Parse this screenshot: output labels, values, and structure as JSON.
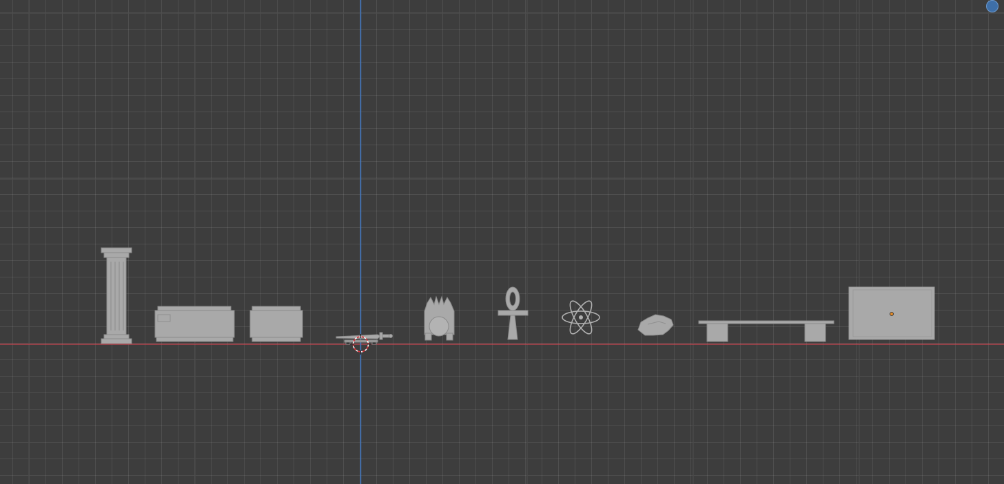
{
  "app": "3D Viewport",
  "view": {
    "mode": "orthographic-front",
    "grid": true
  },
  "axes": {
    "x_axis_color": "#c7444f",
    "z_axis_color": "#3f78c4"
  },
  "colors": {
    "background": "#3d3d3d",
    "mesh": "#a9a9a9",
    "origin_dot": "#e08a2a",
    "cursor_red": "#d9333a",
    "gizmo": "#3e6fa8"
  },
  "icons": {
    "gizmo": "navigation-gizmo-icon",
    "cursor": "3d-cursor-icon"
  },
  "objects": [
    {
      "name": "column"
    },
    {
      "name": "chest-large"
    },
    {
      "name": "chest-small"
    },
    {
      "name": "sword"
    },
    {
      "name": "throne"
    },
    {
      "name": "ankh"
    },
    {
      "name": "atom"
    },
    {
      "name": "rock"
    },
    {
      "name": "bench"
    },
    {
      "name": "panel"
    }
  ]
}
